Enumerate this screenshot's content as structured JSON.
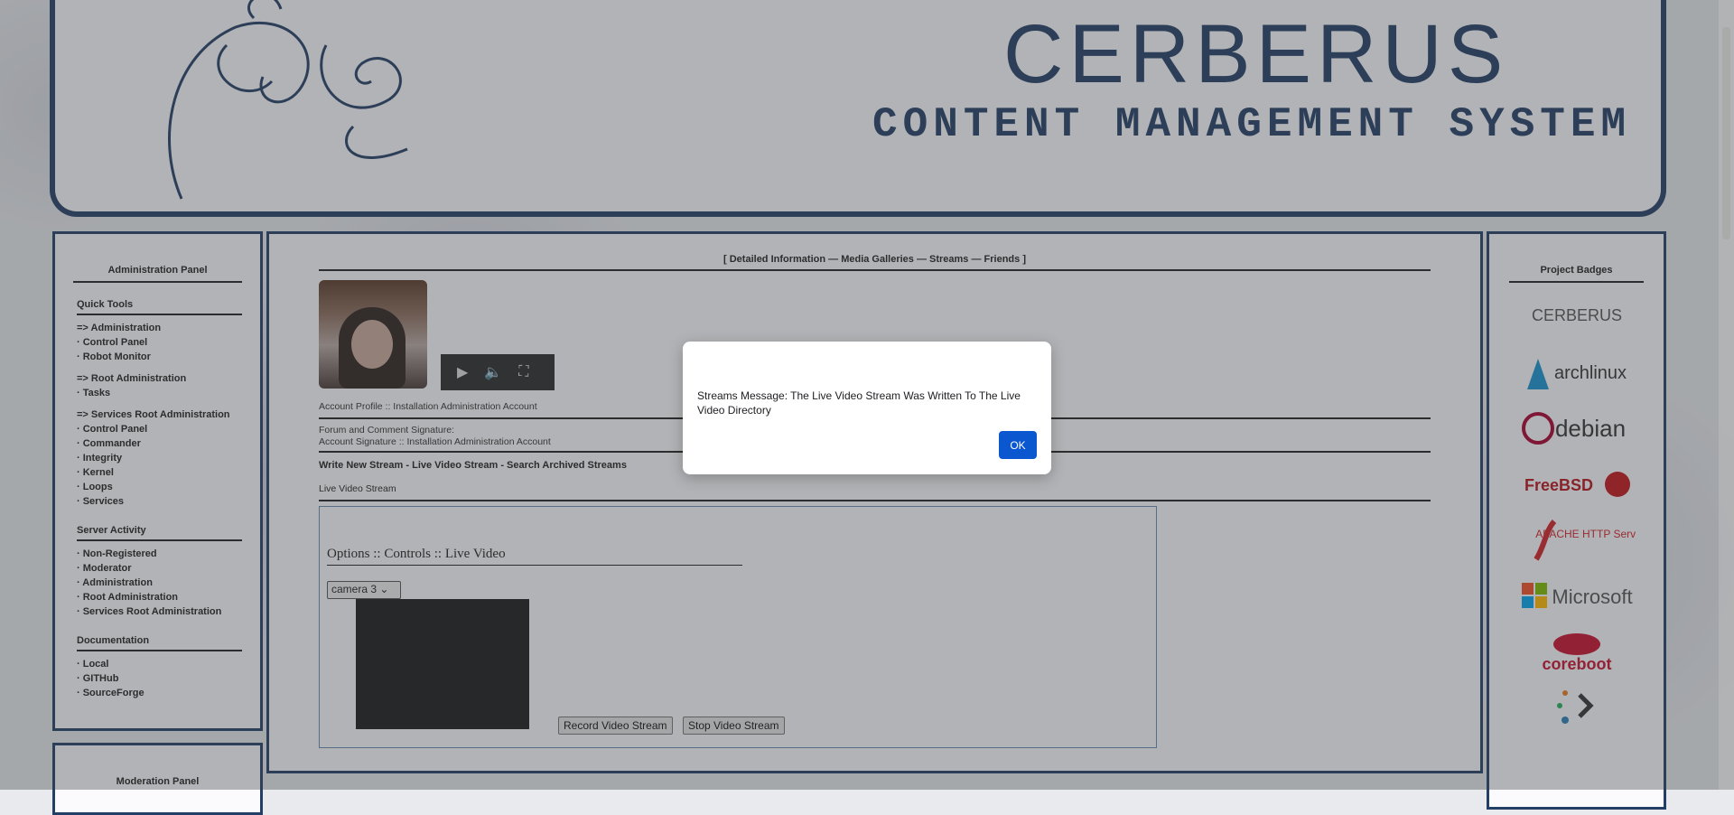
{
  "header": {
    "title": "CERBERUS",
    "subtitle": "CONTENT MANAGEMENT SYSTEM"
  },
  "left_panel": {
    "heading": "Administration Panel",
    "sections": [
      {
        "title": "Quick Tools"
      },
      {
        "title": "Server Activity"
      },
      {
        "title": "Documentation"
      }
    ],
    "quick_tools": [
      "=> Administration",
      "· Control Panel",
      "· Robot Monitor",
      "=> Root Administration",
      "· Tasks",
      "=> Services Root Administration",
      "· Control Panel",
      "· Commander",
      "· Integrity",
      "· Kernel",
      "· Loops",
      "· Services"
    ],
    "server_activity": [
      "· Non-Registered",
      "· Moderator",
      "· Administration",
      "· Root Administration",
      "· Services Root Administration"
    ],
    "documentation": [
      "· Local",
      "· GITHub",
      "· SourceForge"
    ],
    "moderation_heading": "Moderation Panel"
  },
  "center": {
    "tabs_text": "[  Detailed Information — Media Galleries — Streams — Friends  ]",
    "account_profile": "Account Profile :: Installation Administration Account",
    "signature_label": "Forum and Comment Signature:",
    "signature_value": "Account Signature :: Installation Administration Account",
    "stream_links": "Write New Stream - Live Video Stream - Search Archived Streams",
    "live_label": "Live Video Stream",
    "options_title": "Options :: Controls :: Live Video",
    "camera_selected": "camera 3",
    "record_button": "Record Video Stream",
    "stop_button": "Stop Video Stream"
  },
  "right_panel": {
    "heading": "Project Badges",
    "badges": [
      "CERBERUS",
      "archlinux",
      "debian",
      "FreeBSD",
      "APACHE HTTP Server",
      "Microsoft",
      "coreboot"
    ]
  },
  "dialog": {
    "message": "Streams Message: The Live Video Stream Was Written To The Live Video Directory",
    "ok_label": "OK",
    "ok_color": "#0b57d0"
  },
  "colors": {
    "brand": "#243f66"
  }
}
